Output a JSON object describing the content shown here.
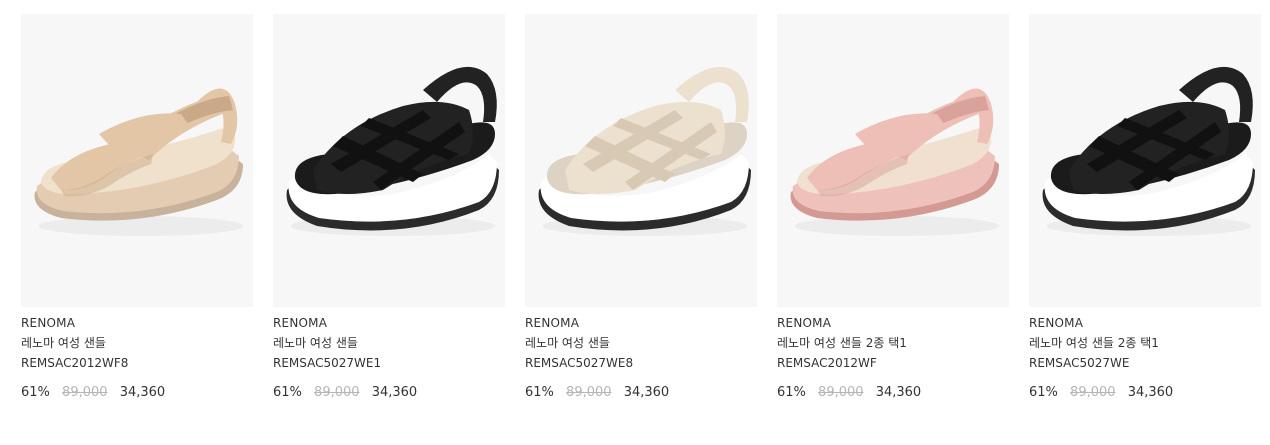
{
  "products": [
    {
      "brand": "RENOMA",
      "name": "레노마 여성 샌들",
      "code": "REMSAC2012WF8",
      "discount": "61%",
      "original_price": "89,000",
      "sale_price": "34,360",
      "style": "velcro",
      "colors": {
        "upper": "#e2c6a6",
        "upper_shade": "#c9a987",
        "footbed": "#efe1cb",
        "sole": "#d8bda0",
        "midsole": "#e4ccb2",
        "outsole": "#c8b29b"
      }
    },
    {
      "brand": "RENOMA",
      "name": "레노마 여성 샌들",
      "code": "REMSAC5027WE1",
      "discount": "61%",
      "original_price": "89,000",
      "sale_price": "34,360",
      "style": "woven",
      "colors": {
        "upper": "#222222",
        "upper_shade": "#111111",
        "footbed": "#1b1b1b",
        "sole": "#f2f2f0",
        "midsole": "#ffffff",
        "outsole": "#2b2b2b"
      }
    },
    {
      "brand": "RENOMA",
      "name": "레노마 여성 샌들",
      "code": "REMSAC5027WE8",
      "discount": "61%",
      "original_price": "89,000",
      "sale_price": "34,360",
      "style": "woven",
      "colors": {
        "upper": "#ece0cf",
        "upper_shade": "#d8c9b4",
        "footbed": "#ddd3c4",
        "sole": "#f4f4f2",
        "midsole": "#ffffff",
        "outsole": "#2b2b2b"
      }
    },
    {
      "brand": "RENOMA",
      "name": "레노마 여성 샌들 2종 택1",
      "code": "REMSAC2012WF",
      "discount": "61%",
      "original_price": "89,000",
      "sale_price": "34,360",
      "style": "velcro",
      "colors": {
        "upper": "#eebfb6",
        "upper_shade": "#d9a29a",
        "footbed": "#f1e0cf",
        "sole": "#e6aea6",
        "midsole": "#eec2ba",
        "outsole": "#d39a93"
      }
    },
    {
      "brand": "RENOMA",
      "name": "레노마 여성 샌들 2종 택1",
      "code": "REMSAC5027WE",
      "discount": "61%",
      "original_price": "89,000",
      "sale_price": "34,360",
      "style": "woven",
      "colors": {
        "upper": "#222222",
        "upper_shade": "#111111",
        "footbed": "#1b1b1b",
        "sole": "#f2f2f0",
        "midsole": "#ffffff",
        "outsole": "#2b2b2b"
      }
    }
  ]
}
